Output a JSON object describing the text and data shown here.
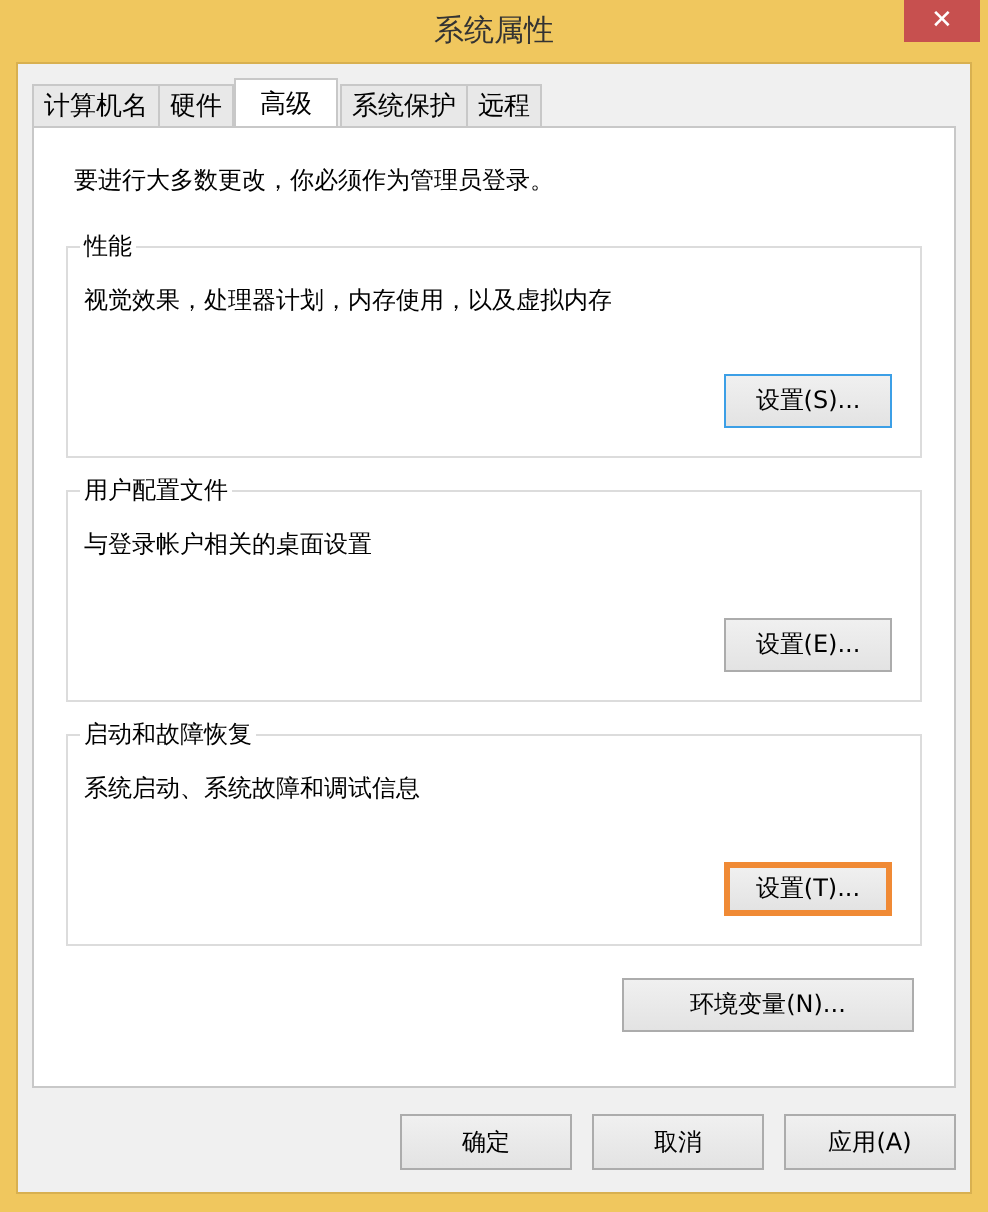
{
  "window": {
    "title": "系统属性",
    "close": "✕"
  },
  "tabs": [
    {
      "label": "计算机名",
      "selected": false
    },
    {
      "label": "硬件",
      "selected": false
    },
    {
      "label": "高级",
      "selected": true
    },
    {
      "label": "系统保护",
      "selected": false
    },
    {
      "label": "远程",
      "selected": false
    }
  ],
  "notice": "要进行大多数更改，你必须作为管理员登录。",
  "groups": [
    {
      "title": "性能",
      "description": "视觉效果，处理器计划，内存使用，以及虚拟内存",
      "button": "设置(S)...",
      "focused": true,
      "highlighted": false
    },
    {
      "title": "用户配置文件",
      "description": "与登录帐户相关的桌面设置",
      "button": "设置(E)...",
      "focused": false,
      "highlighted": false
    },
    {
      "title": "启动和故障恢复",
      "description": "系统启动、系统故障和调试信息",
      "button": "设置(T)...",
      "focused": false,
      "highlighted": true
    }
  ],
  "env_button": "环境变量(N)...",
  "buttons": [
    "确定",
    "取消",
    "应用(A)"
  ]
}
